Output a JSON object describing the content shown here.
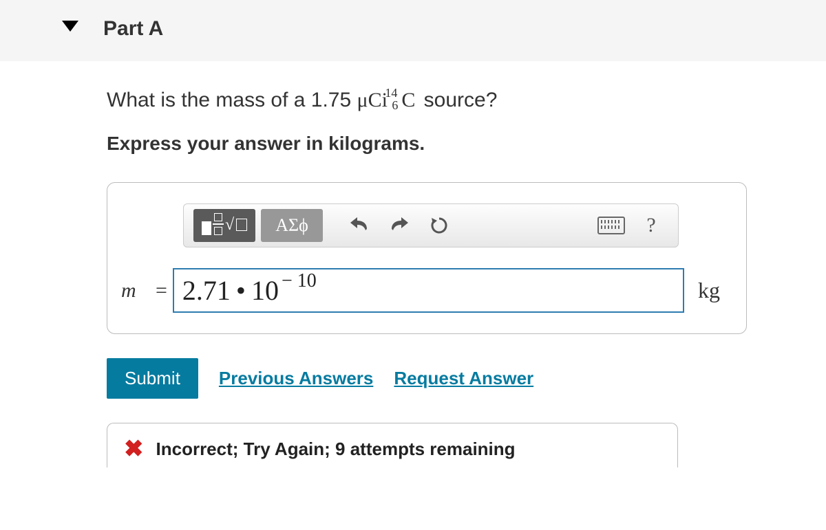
{
  "part": {
    "label": "Part A"
  },
  "question": {
    "prefix": "What is the mass of a 1.75 ",
    "mu": "μ",
    "ci": "Ci",
    "iso_mass": "14",
    "iso_charge": "6",
    "element": "C",
    "suffix": " source?"
  },
  "instruction": "Express your answer in kilograms.",
  "toolbar": {
    "greek_label": "ΑΣϕ",
    "help_label": "?"
  },
  "answer": {
    "variable": "m",
    "equals": "=",
    "base": "2.71",
    "dot": "•",
    "ten": "10",
    "exponent": "− 10",
    "unit": "kg"
  },
  "actions": {
    "submit": "Submit",
    "previous": "Previous Answers",
    "request": "Request Answer"
  },
  "feedback": {
    "text": "Incorrect; Try Again; 9 attempts remaining"
  }
}
